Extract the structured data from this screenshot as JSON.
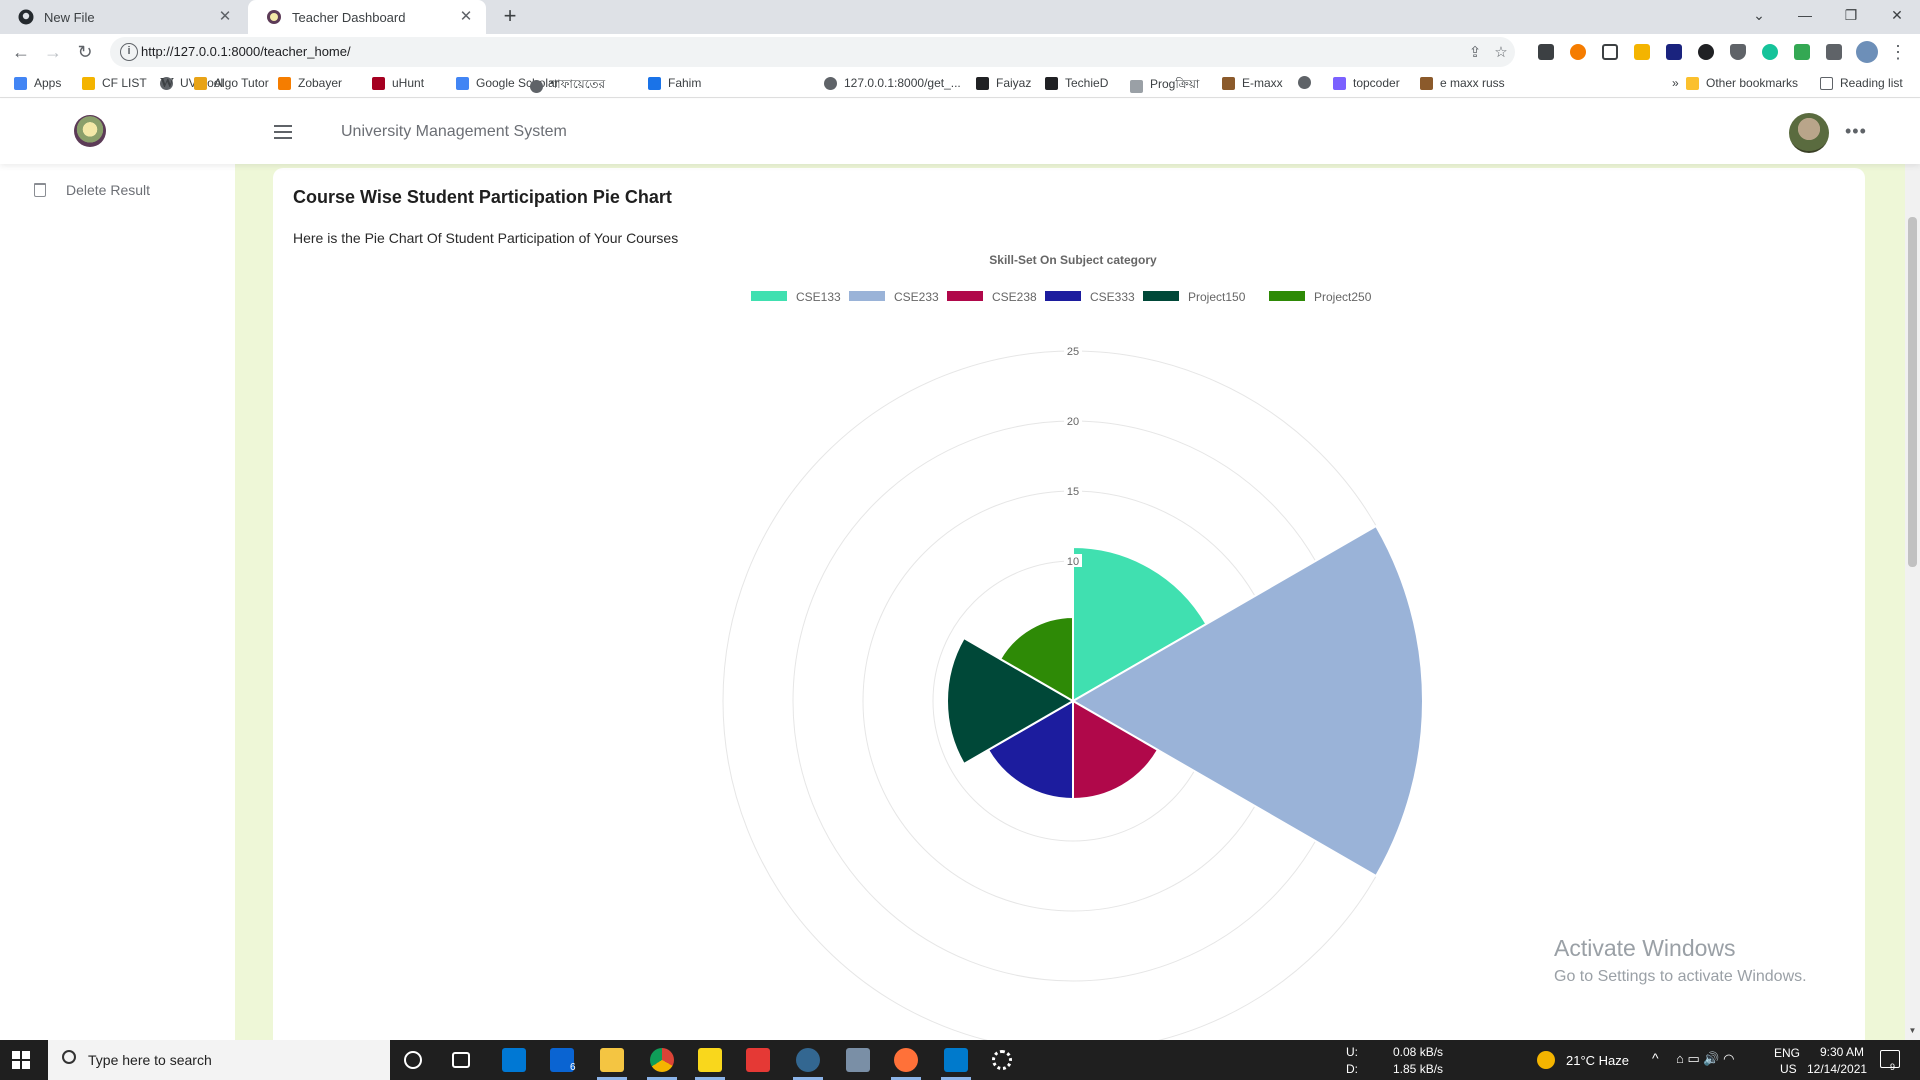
{
  "browser": {
    "tabs": [
      {
        "title": "New File",
        "icon": "github-icon",
        "active": false
      },
      {
        "title": "Teacher Dashboard",
        "icon": "site-logo-icon",
        "active": true
      }
    ],
    "url": "http://127.0.0.1:8000/teacher_home/",
    "bookmarks": [
      {
        "label": "Apps",
        "icon": "apps-grid-icon",
        "color": "#4285f4"
      },
      {
        "label": "CF LIST",
        "icon": "bar-chart-icon",
        "color": "#f4b400"
      },
      {
        "label": "UVAtool",
        "icon": "globe-icon",
        "color": "#5f6368"
      },
      {
        "label": "Algo Tutor",
        "icon": "curly-brace-icon",
        "color": "#e8a317"
      },
      {
        "label": "Zobayer",
        "icon": "blogger-icon",
        "color": "#f57d00"
      },
      {
        "label": "uHunt",
        "icon": "uva-icon",
        "color": "#a50021"
      },
      {
        "label": "Google Scholar",
        "icon": "scholar-cap-icon",
        "color": "#4285f4"
      },
      {
        "label": "শাফায়েতের",
        "icon": "globe-icon",
        "color": "#5f6368"
      },
      {
        "label": "Fahim",
        "icon": "layout-icon",
        "color": "#1a73e8"
      },
      {
        "label": "127.0.0.1:8000/get_...",
        "icon": "globe-icon",
        "color": "#5f6368"
      },
      {
        "label": "Faiyaz",
        "icon": "s-logo-icon",
        "color": "#202124"
      },
      {
        "label": "TechieD",
        "icon": "td-logo-icon",
        "color": "#202124"
      },
      {
        "label": "Progক্রিয়া",
        "icon": "page-icon",
        "color": "#9aa0a6"
      },
      {
        "label": "E-maxx",
        "icon": "emaxx-icon",
        "color": "#8b5a2b"
      },
      {
        "label": "",
        "icon": "globe-icon",
        "color": "#5f6368"
      },
      {
        "label": "topcoder",
        "icon": "topcoder-icon",
        "color": "#7b61ff"
      },
      {
        "label": "e maxx russ",
        "icon": "emaxx-icon",
        "color": "#8b5a2b"
      }
    ],
    "other_bookmarks": "Other bookmarks",
    "reading_list": "Reading list",
    "overflow": "»"
  },
  "app": {
    "title": "University Management System",
    "more": "•••"
  },
  "sidebar": {
    "items": [
      {
        "label": "Delete Result",
        "icon": "trash-icon"
      }
    ]
  },
  "card": {
    "title": "Course Wise Student Participation Pie Chart",
    "subtitle": "Here is the Pie Chart Of Student Participation of Your Courses"
  },
  "chart_data": {
    "type": "polar-area",
    "title": "Skill-Set On Subject category",
    "categories": [
      "CSE133",
      "CSE233",
      "CSE238",
      "CSE333",
      "Project150",
      "Project250"
    ],
    "values": [
      11,
      25,
      7,
      7,
      9,
      6
    ],
    "colors": [
      "#40e0b0",
      "#9ab3d8",
      "#b0084a",
      "#1c1c9e",
      "#004838",
      "#2e8a06"
    ],
    "r_ticks": [
      "25",
      "20",
      "15",
      "10"
    ],
    "r_range": [
      0,
      25
    ],
    "legend_position": "top",
    "grid": true
  },
  "watermark": {
    "line1": "Activate Windows",
    "line2": "Go to Settings to activate Windows."
  },
  "taskbar": {
    "search_placeholder": "Type here to search",
    "net_up_label": "U:",
    "net_down_label": "D:",
    "net_up": "0.08 kB/s",
    "net_down": "1.85 kB/s",
    "weather": "21°C  Haze",
    "lang": "ENG",
    "region": "US",
    "time": "9:30 AM",
    "date": "12/14/2021",
    "mail_badge": "6",
    "notif_badge": "9"
  }
}
